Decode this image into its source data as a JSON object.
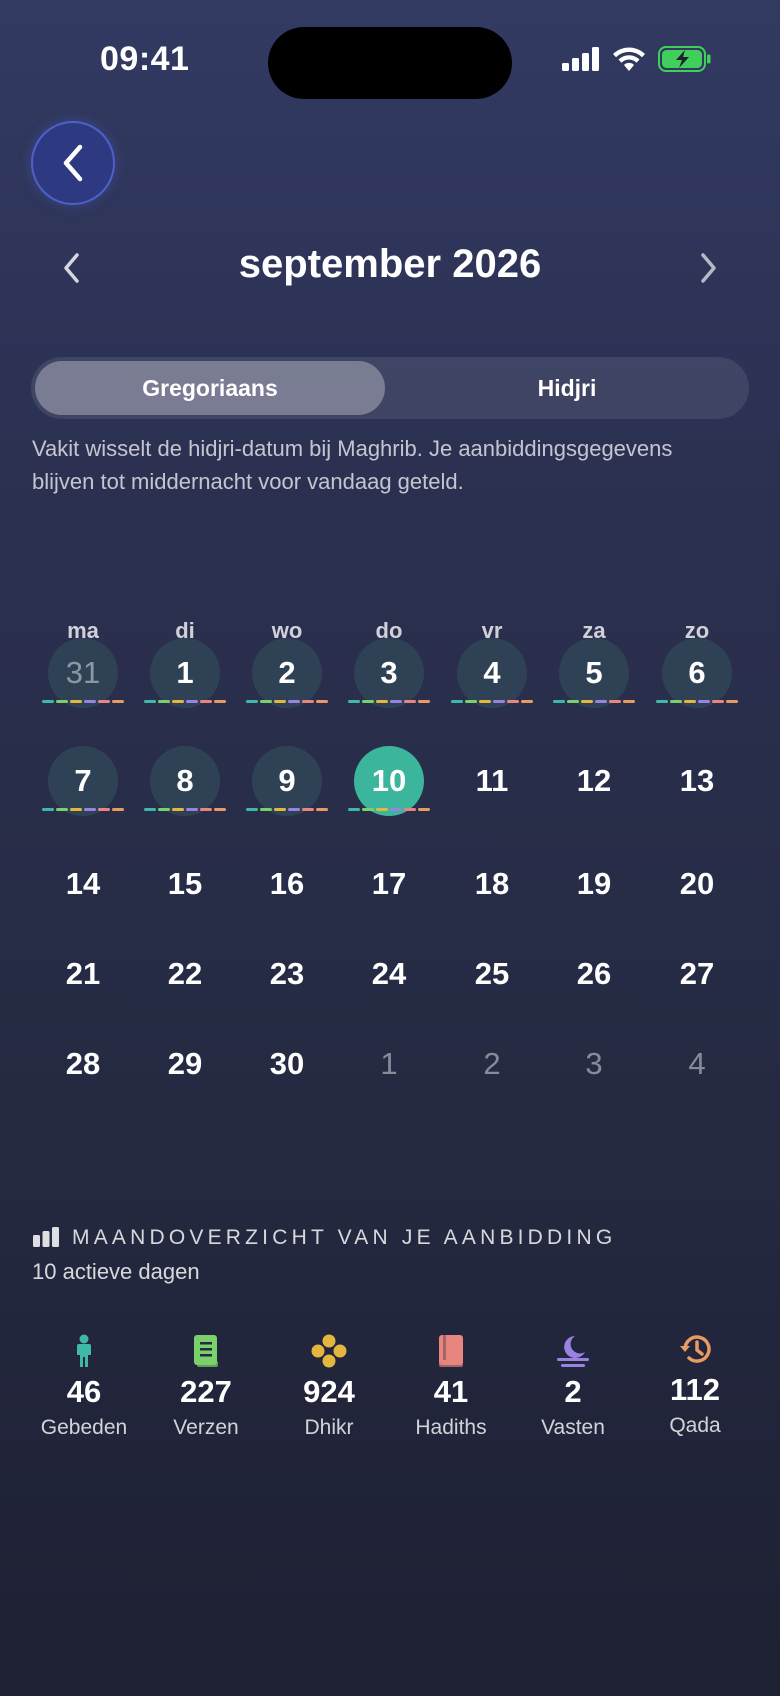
{
  "status_bar": {
    "time": "09:41"
  },
  "header": {
    "month_title": "september 2026"
  },
  "segmented": {
    "options": [
      "Gregoriaans",
      "Hidjri"
    ],
    "selected": "Gregoriaans"
  },
  "info_text": "Vakit wisselt de hidjri-datum bij Maghrib. Je aanbiddingsgegevens blijven tot middernacht voor vandaag geteld.",
  "calendar": {
    "weekdays": [
      "ma",
      "di",
      "wo",
      "do",
      "vr",
      "za",
      "zo"
    ],
    "weeks": [
      [
        {
          "d": "31",
          "out": true,
          "active": true
        },
        {
          "d": "1",
          "active": true
        },
        {
          "d": "2",
          "active": true
        },
        {
          "d": "3",
          "active": true
        },
        {
          "d": "4",
          "active": true
        },
        {
          "d": "5",
          "active": true
        },
        {
          "d": "6",
          "active": true
        }
      ],
      [
        {
          "d": "7",
          "active": true
        },
        {
          "d": "8",
          "active": true
        },
        {
          "d": "9",
          "active": true
        },
        {
          "d": "10",
          "active": true,
          "today": true
        },
        {
          "d": "11"
        },
        {
          "d": "12"
        },
        {
          "d": "13"
        }
      ],
      [
        {
          "d": "14"
        },
        {
          "d": "15"
        },
        {
          "d": "16"
        },
        {
          "d": "17"
        },
        {
          "d": "18"
        },
        {
          "d": "19"
        },
        {
          "d": "20"
        }
      ],
      [
        {
          "d": "21"
        },
        {
          "d": "22"
        },
        {
          "d": "23"
        },
        {
          "d": "24"
        },
        {
          "d": "25"
        },
        {
          "d": "26"
        },
        {
          "d": "27"
        }
      ],
      [
        {
          "d": "28"
        },
        {
          "d": "29"
        },
        {
          "d": "30"
        },
        {
          "d": "1",
          "out": true
        },
        {
          "d": "2",
          "out": true
        },
        {
          "d": "3",
          "out": true
        },
        {
          "d": "4",
          "out": true
        }
      ]
    ],
    "activity_colors": [
      "#3fb8a8",
      "#7ad06a",
      "#e3b63d",
      "#9a82e3",
      "#e8857f",
      "#e89a63"
    ]
  },
  "summary": {
    "title": "MAANDOVERZICHT VAN JE AANBIDDING",
    "subtitle": "10 actieve dagen",
    "stats": [
      {
        "value": "46",
        "label": "Gebeden",
        "icon": "person-icon",
        "color": "#3fb8a8"
      },
      {
        "value": "227",
        "label": "Verzen",
        "icon": "book-icon",
        "color": "#7ad06a"
      },
      {
        "value": "924",
        "label": "Dhikr",
        "icon": "beads-icon",
        "color": "#e3b63d"
      },
      {
        "value": "41",
        "label": "Hadiths",
        "icon": "hadith-book-icon",
        "color": "#e8857f"
      },
      {
        "value": "2",
        "label": "Vasten",
        "icon": "moon-icon",
        "color": "#9a82e3"
      },
      {
        "value": "112",
        "label": "Qada",
        "icon": "history-icon",
        "color": "#e89a63"
      }
    ]
  }
}
